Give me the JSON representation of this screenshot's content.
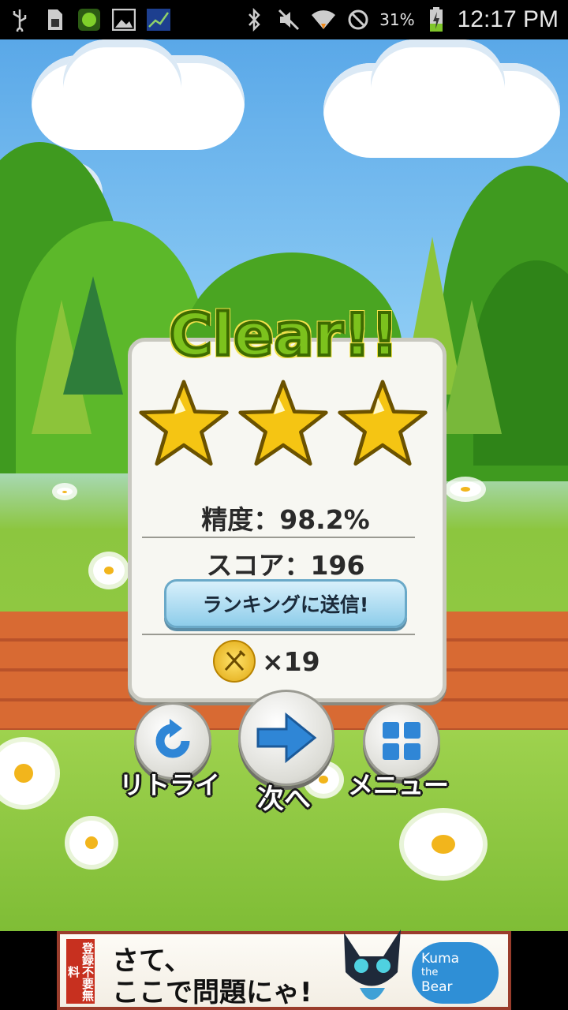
{
  "status_bar": {
    "battery_percent": "31%",
    "time": "12:17 PM",
    "icons": [
      "usb-icon",
      "sd-card-icon",
      "app-notification-icon",
      "image-icon",
      "chart-app-icon",
      "bluetooth-icon",
      "mute-icon",
      "wifi-icon",
      "no-sim-icon",
      "battery-charging-icon"
    ]
  },
  "result": {
    "title": "Clear!!",
    "stars_earned": 3,
    "stars_total": 3,
    "accuracy": "精度：98.2%",
    "score": "スコア：196",
    "send_ranking": "ランキングに送信!",
    "coin_count": "×19"
  },
  "buttons": {
    "retry": "リトライ",
    "next": "次へ",
    "menu": "メニュー"
  },
  "ad": {
    "badge": "登録不要無料",
    "line1": "さて、",
    "line2": "ここで問題にゃ!",
    "logo": [
      "Kuma",
      "the",
      "Bear"
    ]
  },
  "colors": {
    "clear_title": "#7cc21d",
    "star": "#f5c513",
    "arrow": "#2f86d6",
    "ad_border": "#9a3d2c"
  }
}
